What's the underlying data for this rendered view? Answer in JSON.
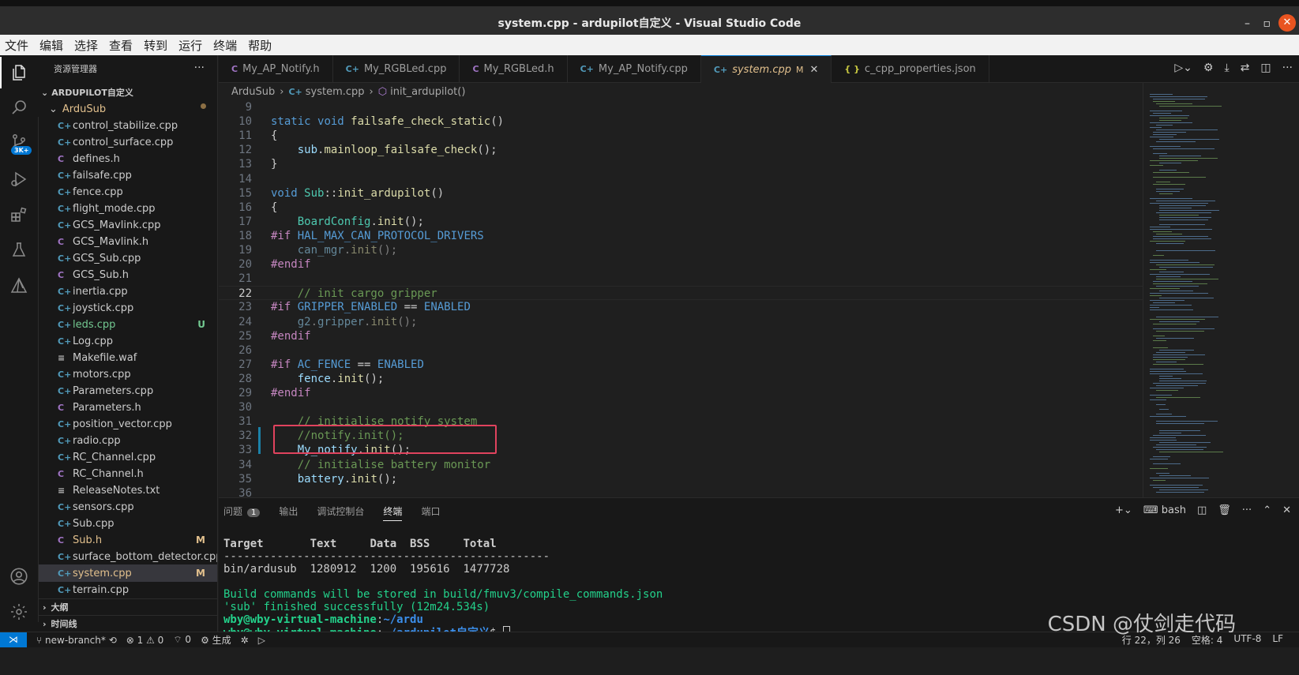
{
  "window": {
    "title": "system.cpp - ardupilot自定义 - Visual Studio Code",
    "minimize": "–",
    "maximize": "▫",
    "close": "✕"
  },
  "menu": [
    "文件",
    "编辑",
    "选择",
    "查看",
    "转到",
    "运行",
    "终端",
    "帮助"
  ],
  "activity": {
    "scm_badge": "3K+"
  },
  "explorer": {
    "header": "资源管理器",
    "more": "···",
    "root": "ARDUPILOT自定义",
    "folder": "ArduSub",
    "files": [
      {
        "name": "control_stabilize.cpp",
        "kind": "cpp",
        "git": ""
      },
      {
        "name": "control_surface.cpp",
        "kind": "cpp",
        "git": ""
      },
      {
        "name": "defines.h",
        "kind": "h",
        "git": ""
      },
      {
        "name": "failsafe.cpp",
        "kind": "cpp",
        "git": ""
      },
      {
        "name": "fence.cpp",
        "kind": "cpp",
        "git": ""
      },
      {
        "name": "flight_mode.cpp",
        "kind": "cpp",
        "git": ""
      },
      {
        "name": "GCS_Mavlink.cpp",
        "kind": "cpp",
        "git": ""
      },
      {
        "name": "GCS_Mavlink.h",
        "kind": "h",
        "git": ""
      },
      {
        "name": "GCS_Sub.cpp",
        "kind": "cpp",
        "git": ""
      },
      {
        "name": "GCS_Sub.h",
        "kind": "h",
        "git": ""
      },
      {
        "name": "inertia.cpp",
        "kind": "cpp",
        "git": ""
      },
      {
        "name": "joystick.cpp",
        "kind": "cpp",
        "git": ""
      },
      {
        "name": "leds.cpp",
        "kind": "cpp",
        "git": "U"
      },
      {
        "name": "Log.cpp",
        "kind": "cpp",
        "git": ""
      },
      {
        "name": "Makefile.waf",
        "kind": "txt",
        "git": ""
      },
      {
        "name": "motors.cpp",
        "kind": "cpp",
        "git": ""
      },
      {
        "name": "Parameters.cpp",
        "kind": "cpp",
        "git": ""
      },
      {
        "name": "Parameters.h",
        "kind": "h",
        "git": ""
      },
      {
        "name": "position_vector.cpp",
        "kind": "cpp",
        "git": ""
      },
      {
        "name": "radio.cpp",
        "kind": "cpp",
        "git": ""
      },
      {
        "name": "RC_Channel.cpp",
        "kind": "cpp",
        "git": ""
      },
      {
        "name": "RC_Channel.h",
        "kind": "h",
        "git": ""
      },
      {
        "name": "ReleaseNotes.txt",
        "kind": "txt",
        "git": ""
      },
      {
        "name": "sensors.cpp",
        "kind": "cpp",
        "git": ""
      },
      {
        "name": "Sub.cpp",
        "kind": "cpp",
        "git": ""
      },
      {
        "name": "Sub.h",
        "kind": "h",
        "git": "M"
      },
      {
        "name": "surface_bottom_detector.cpp",
        "kind": "cpp",
        "git": ""
      },
      {
        "name": "system.cpp",
        "kind": "cpp",
        "git": "M"
      },
      {
        "name": "terrain.cpp",
        "kind": "cpp",
        "git": ""
      }
    ],
    "outline": "大纲",
    "timeline": "时间线"
  },
  "tabs": [
    {
      "label": "My_AP_Notify.h",
      "kind": "h"
    },
    {
      "label": "My_RGBLed.cpp",
      "kind": "cpp"
    },
    {
      "label": "My_RGBLed.h",
      "kind": "h"
    },
    {
      "label": "My_AP_Notify.cpp",
      "kind": "cpp"
    },
    {
      "label": "system.cpp",
      "kind": "cpp",
      "active": true,
      "mod": "M"
    },
    {
      "label": "c_cpp_properties.json",
      "kind": "json"
    }
  ],
  "breadcrumb": {
    "folder": "ArduSub",
    "file": "system.cpp",
    "symbol": "init_ardupilot()"
  },
  "code": [
    {
      "n": "9",
      "html": ""
    },
    {
      "n": "10",
      "html": "<span class=\"kw\">static</span> <span class=\"kw\">void</span> <span class=\"fn\">failsafe_check_static</span>()"
    },
    {
      "n": "11",
      "html": "{"
    },
    {
      "n": "12",
      "html": "    <span class=\"var\">sub</span>.<span class=\"fn\">mainloop_failsafe_check</span>();"
    },
    {
      "n": "13",
      "html": "}"
    },
    {
      "n": "14",
      "html": ""
    },
    {
      "n": "15",
      "html": "<span class=\"kw\">void</span> <span class=\"cls\">Sub</span>::<span class=\"fn\">init_ardupilot</span>()"
    },
    {
      "n": "16",
      "html": "{"
    },
    {
      "n": "17",
      "html": "    <span class=\"cls\">BoardConfig</span>.<span class=\"fn\">init</span>();"
    },
    {
      "n": "18",
      "html": "<span class=\"pre\">#if</span> <span class=\"kw\">HAL_MAX_CAN_PROTOCOL_DRIVERS</span>"
    },
    {
      "n": "19",
      "html": "<span class=\"dim\">    <span class=\"var\">can_mgr</span>.<span class=\"fn\">init</span>();</span>"
    },
    {
      "n": "20",
      "html": "<span class=\"pre\">#endif</span>"
    },
    {
      "n": "21",
      "html": ""
    },
    {
      "n": "22",
      "html": "    <span class=\"cmt\">// init cargo gripper</span>",
      "current": true
    },
    {
      "n": "23",
      "html": "<span class=\"pre\">#if</span> <span class=\"kw\">GRIPPER_ENABLED</span> == <span class=\"kw\">ENABLED</span>"
    },
    {
      "n": "24",
      "html": "<span class=\"dim\">    <span class=\"var\">g2</span>.<span class=\"var\">gripper</span>.<span class=\"fn\">init</span>();</span>"
    },
    {
      "n": "25",
      "html": "<span class=\"pre\">#endif</span>"
    },
    {
      "n": "26",
      "html": ""
    },
    {
      "n": "27",
      "html": "<span class=\"pre\">#if</span> <span class=\"kw\">AC_FENCE</span> == <span class=\"kw\">ENABLED</span>"
    },
    {
      "n": "28",
      "html": "    <span class=\"var\">fence</span>.<span class=\"fn\">init</span>();"
    },
    {
      "n": "29",
      "html": "<span class=\"pre\">#endif</span>"
    },
    {
      "n": "30",
      "html": ""
    },
    {
      "n": "31",
      "html": "    <span class=\"cmt\">// initialise notify system</span>"
    },
    {
      "n": "32",
      "html": "    <span class=\"cmt\">//notify.init();</span>"
    },
    {
      "n": "33",
      "html": "    <span class=\"var\">My_notify</span>.<span class=\"fn\">init</span>();"
    },
    {
      "n": "34",
      "html": "    <span class=\"cmt\">// initialise battery monitor</span>"
    },
    {
      "n": "35",
      "html": "    <span class=\"var\">battery</span>.<span class=\"fn\">init</span>();"
    },
    {
      "n": "36",
      "html": ""
    }
  ],
  "panel": {
    "tabs": [
      "问题",
      "输出",
      "调试控制台",
      "终端",
      "端口"
    ],
    "active_tab": "终端",
    "problems_count": "1",
    "shell": "bash",
    "terminal": {
      "header": [
        "Target",
        "Text",
        "Data",
        "BSS",
        "Total"
      ],
      "rule": "-------------------------------------------------",
      "row": [
        "bin/ardusub",
        "1280912",
        "1200",
        "195616",
        "1477728"
      ],
      "line1": "Build commands will be stored in build/fmuv3/compile_commands.json",
      "line2": "'sub' finished successfully (12m24.534s)",
      "prompt1_user": "wby@wby-virtual-machine",
      "prompt1_path": "~/ardu",
      "prompt2_user": "wby@wby-virtual-machine",
      "prompt2_path": "~/ardupilot自定义",
      "prompt_symbol": "$"
    }
  },
  "status": {
    "branch": "new-branch*",
    "errors": "⊗ 1",
    "warnings": "⚠ 0",
    "ports": "0",
    "build": "生成",
    "position": "行 22，列 26",
    "spaces": "空格: 4",
    "encoding": "UTF-8",
    "eol": "LF"
  },
  "watermark": "CSDN @仗剑走代码"
}
